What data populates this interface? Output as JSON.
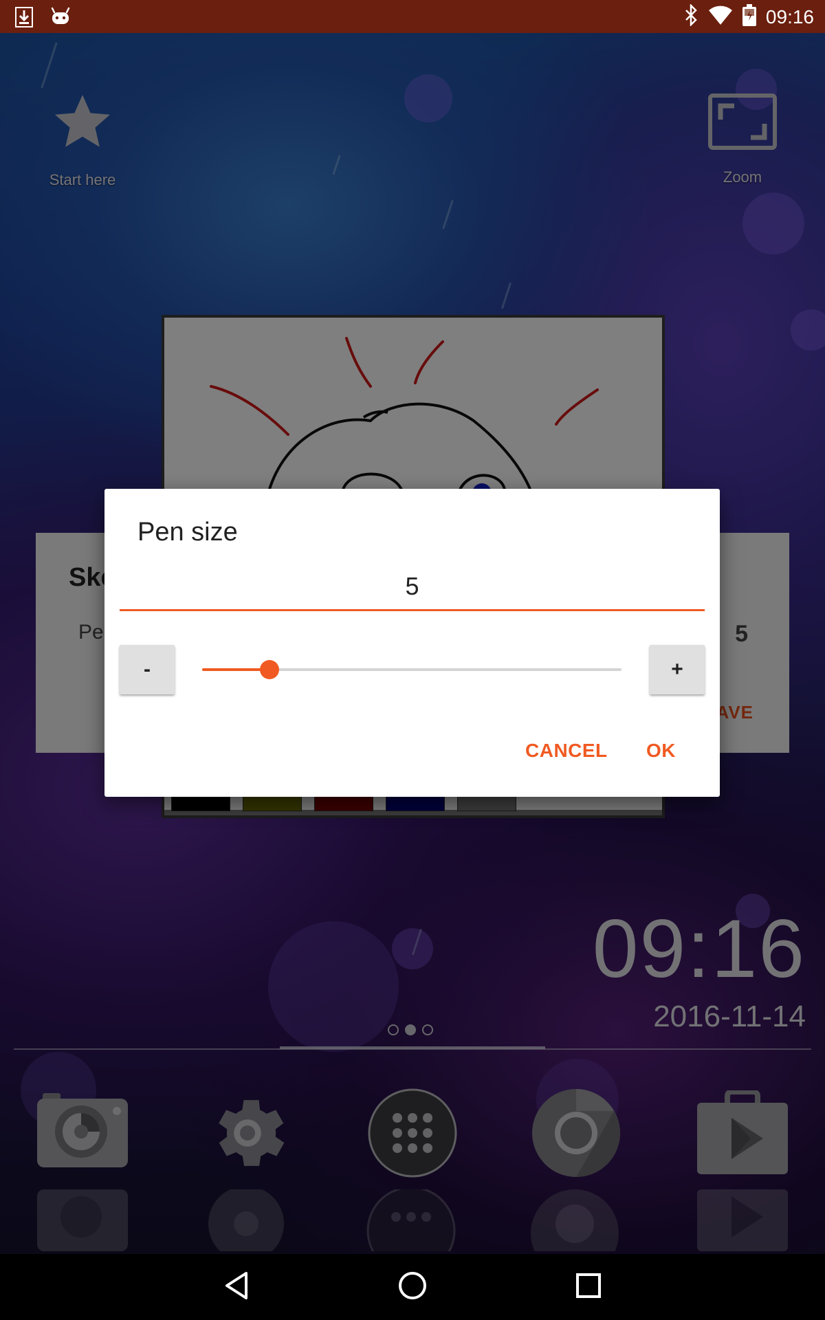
{
  "status_bar": {
    "time": "09:16",
    "left_icons": [
      "download-icon",
      "android-icon"
    ],
    "right_icons": [
      "bluetooth-icon",
      "wifi-icon",
      "battery-icon"
    ]
  },
  "home": {
    "shortcut_start": {
      "label": "Start here",
      "icon": "star-icon"
    },
    "shortcut_zoom": {
      "label": "Zoom",
      "icon": "zoom-icon"
    },
    "clock_widget": {
      "time": "09:16",
      "date": "2016-11-14"
    },
    "page_indicator": {
      "pages": 3,
      "current": 2
    },
    "dock": [
      "camera-icon",
      "settings-icon",
      "app-drawer-icon",
      "chrome-icon",
      "play-store-icon"
    ]
  },
  "background_app": {
    "card_title": "Ske",
    "card_label": "Pe",
    "card_value": "5",
    "card_action": "AVE",
    "palette_colors": [
      "#000000",
      "#6b6b00",
      "#7a0000",
      "#00007a",
      "#7a7a7a"
    ]
  },
  "dialog": {
    "title": "Pen size",
    "value": "5",
    "minus_label": "-",
    "plus_label": "+",
    "slider_fraction": 0.16,
    "cancel_label": "CANCEL",
    "ok_label": "OK",
    "accent": "#f05a22"
  },
  "nav_bar": {
    "buttons": [
      "back-icon",
      "home-icon",
      "recents-icon"
    ]
  }
}
